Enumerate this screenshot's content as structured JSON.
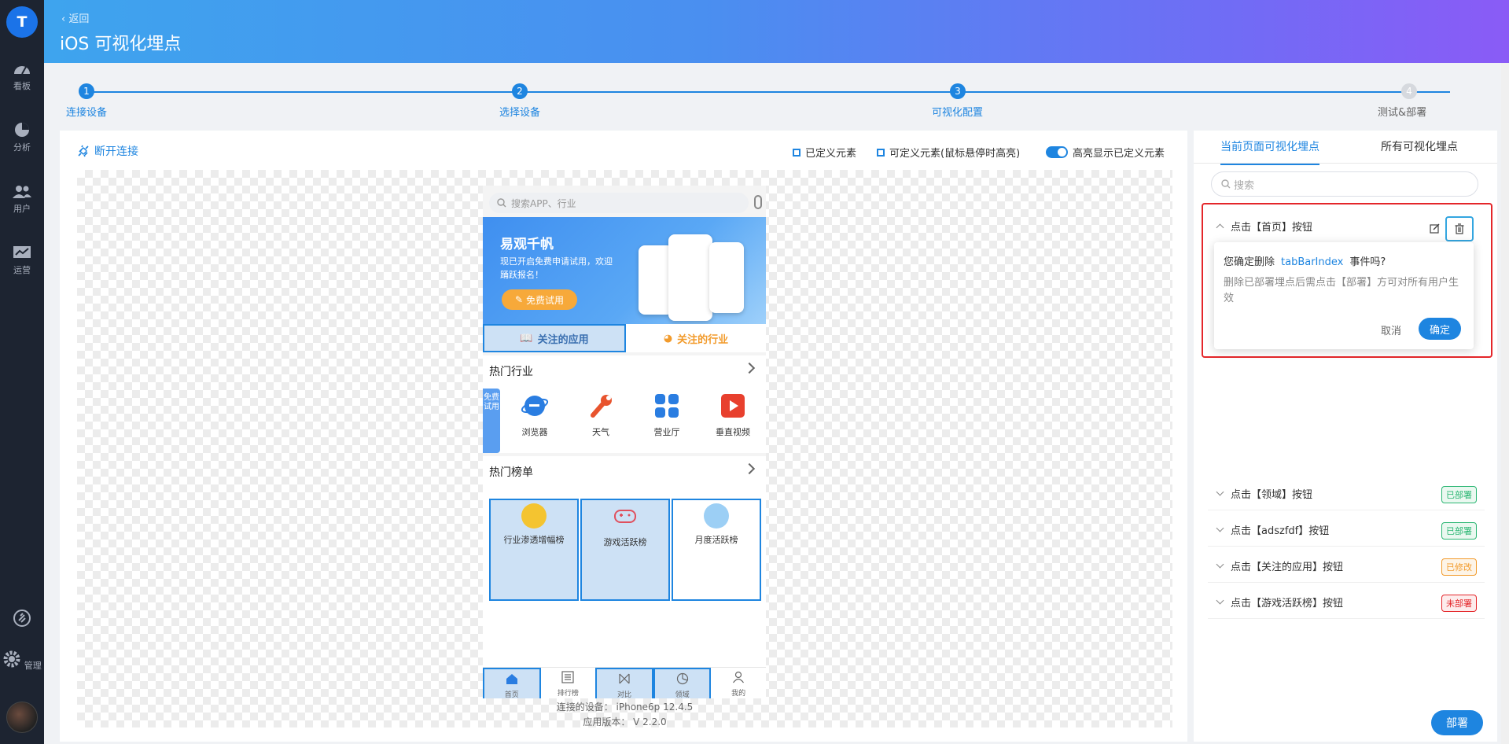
{
  "sidebar": {
    "avatar_letter": "T",
    "items": [
      {
        "label": "看板",
        "icon": "dashboard-icon"
      },
      {
        "label": "分析",
        "icon": "pie-chart-icon"
      },
      {
        "label": "用户",
        "icon": "users-icon"
      },
      {
        "label": "运营",
        "icon": "operations-icon"
      }
    ],
    "bottom": [
      {
        "label": "",
        "icon": "link-icon"
      },
      {
        "label": "管理",
        "icon": "gear-icon"
      }
    ]
  },
  "header": {
    "back": "返回",
    "title": "iOS 可视化埋点"
  },
  "steps": [
    {
      "num": "1",
      "label": "连接设备",
      "state": "done"
    },
    {
      "num": "2",
      "label": "选择设备",
      "state": "done"
    },
    {
      "num": "3",
      "label": "可视化配置",
      "state": "active"
    },
    {
      "num": "4",
      "label": "测试&部署",
      "state": "pending"
    }
  ],
  "toolbar": {
    "disconnect": "断开连接",
    "legend_defined": "已定义元素",
    "legend_definable": "可定义元素(鼠标悬停时高亮)",
    "highlight_toggle": "高亮显示已定义元素"
  },
  "phone": {
    "search_placeholder": "搜索APP、行业",
    "banner": {
      "title": "易观千帆",
      "subtitle": "现已开启免费申请试用，欢迎踊跃报名！",
      "button": "免费试用"
    },
    "tabs": [
      "关注的应用",
      "关注的行业"
    ],
    "hot_industry": {
      "title": "热门行业",
      "free_tag": "免费试用",
      "items": [
        "浏览器",
        "天气",
        "营业厅",
        "垂直视频"
      ]
    },
    "hot_rank": {
      "title": "热门榜单",
      "items": [
        "行业渗透增幅榜",
        "游戏活跃榜",
        "月度活跃榜"
      ]
    },
    "bottom_tabs": [
      "首页",
      "排行榜",
      "对比",
      "领域",
      "我的"
    ]
  },
  "device_info": {
    "device": "连接的设备： iPhone6p 12.4.5",
    "version": "应用版本： V 2.2.0"
  },
  "right_panel": {
    "tabs": [
      "当前页面可视化埋点",
      "所有可视化埋点"
    ],
    "search_placeholder": "搜索",
    "events": [
      {
        "label": "点击【首页】按钮",
        "status": ""
      },
      {
        "label": "点击【领域】按钮",
        "status": "已部署"
      },
      {
        "label": "点击【adszfdf】按钮",
        "status": "已部署"
      },
      {
        "label": "点击【关注的应用】按钮",
        "status": "已修改"
      },
      {
        "label": "点击【游戏活跃榜】按钮",
        "status": "未部署"
      }
    ],
    "popover": {
      "question_prefix": "您确定删除",
      "event_name": "tabBarIndex",
      "question_suffix": "事件吗?",
      "note": "删除已部署埋点后需点击【部署】方可对所有用户生效",
      "cancel": "取消",
      "ok": "确定"
    },
    "deploy": "部署"
  },
  "colors": {
    "accent": "#1e85e0",
    "danger": "#e4262a",
    "success": "#2bb673",
    "warning": "#f29b2c",
    "sidebar_bg": "#1d2431"
  }
}
